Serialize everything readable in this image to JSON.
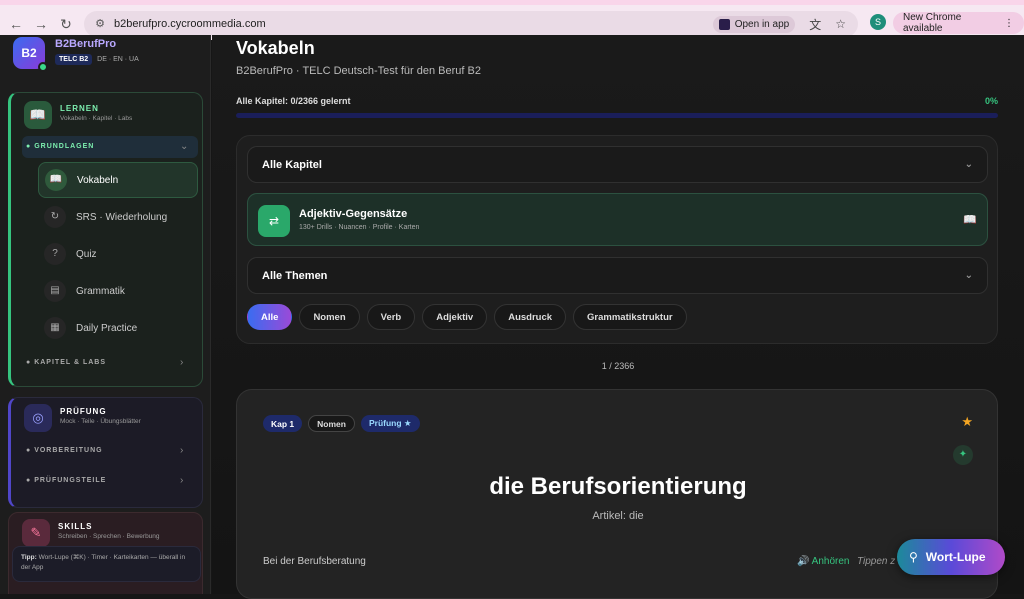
{
  "browser": {
    "url": "b2berufpro.cycroommedia.com",
    "open_in_app": "Open in app",
    "profile_initial": "S",
    "new_chrome": "New Chrome available"
  },
  "sidebar": {
    "logo": "B2",
    "brand": "B2BerufPro",
    "level_badge": "TELC B2",
    "languages": "DE · EN · UA",
    "learn": {
      "title": "LERNEN",
      "subtitle": "Vokabeln · Kapitel · Labs",
      "section": "GRUNDLAGEN",
      "items": [
        {
          "label": "Vokabeln",
          "icon": "book-icon"
        },
        {
          "label": "SRS · Wiederholung",
          "icon": "refresh-icon"
        },
        {
          "label": "Quiz",
          "icon": "question-icon"
        },
        {
          "label": "Grammatik",
          "icon": "notebook-icon"
        },
        {
          "label": "Daily Practice",
          "icon": "calendar-icon"
        }
      ],
      "section2": "KAPITEL & LABS"
    },
    "exam": {
      "title": "PRÜFUNG",
      "subtitle": "Mock · Teile · Übungsblätter",
      "section1": "VORBEREITUNG",
      "section2": "PRÜFUNGSTEILE"
    },
    "skills": {
      "title": "SKILLS",
      "subtitle": "Schreiben · Sprechen · Bewerbung"
    },
    "tip_label": "Tipp:",
    "tip_text": "Wort-Lupe (⌘K) · Timer · Karteikarten — überall in der App"
  },
  "main": {
    "title": "Vokabeln",
    "subtitle": "B2BerufPro · TELC Deutsch-Test für den Beruf B2",
    "progress_label": "Alle Kapitel: 0/2366 gelernt",
    "progress_pct": "0%",
    "progress_value": 0,
    "chapter_select": "Alle Kapitel",
    "adj_title": "Adjektiv-Gegensätze",
    "adj_sub": "130+ Drills · Nuancen · Profile · Karten",
    "theme_select": "Alle Themen",
    "chips": [
      "Alle",
      "Nomen",
      "Verb",
      "Adjektiv",
      "Ausdruck",
      "Grammatikstruktur"
    ],
    "counter": "1 / 2366",
    "card": {
      "tag_chapter": "Kap 1",
      "tag_type": "Nomen",
      "tag_exam": "Prüfung ★",
      "word": "die Berufsorientierung",
      "article": "Artikel: die",
      "example": "Bei der Berufsberatung",
      "listen": "🔊 Anhören",
      "tap": "Tippen z"
    },
    "lupe": "Wort-Lupe"
  }
}
